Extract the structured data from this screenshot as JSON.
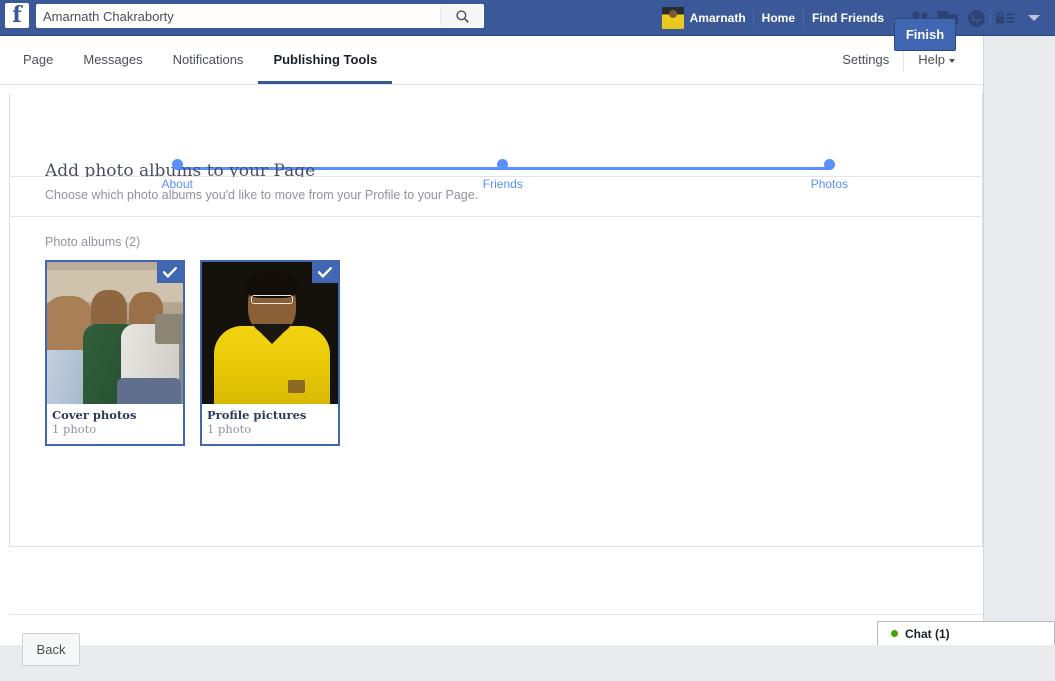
{
  "topbar": {
    "logo": "f",
    "search": {
      "value": "Amarnath Chakraborty",
      "placeholder": "Search",
      "icon": "search-icon"
    },
    "user_name": "Amarnath",
    "home_label": "Home",
    "find_friends_label": "Find Friends",
    "icons": [
      "friend-requests-icon",
      "messages-icon",
      "notifications-globe-icon",
      "privacy-lock-icon",
      "account-dropdown-icon"
    ],
    "background_color": "#3b5998"
  },
  "tabbar": {
    "tabs": [
      {
        "label": "Page",
        "active": false
      },
      {
        "label": "Messages",
        "active": false
      },
      {
        "label": "Notifications",
        "active": false
      },
      {
        "label": "Publishing Tools",
        "active": true
      }
    ],
    "settings_label": "Settings",
    "help_label": "Help",
    "active_color": "#365899"
  },
  "wizard": {
    "steps": [
      {
        "label": "About",
        "left_pct": 17.2
      },
      {
        "label": "Friends",
        "left_pct": 50.7
      },
      {
        "label": "Photos",
        "left_pct": 84.3
      }
    ],
    "step_color": "#5890ff",
    "heading": "Add photo albums to your Page",
    "subheading": "Choose which photo albums you'd like to move from your Profile to your Page.",
    "albums_title": "Photo albums (2)",
    "albums": [
      {
        "name": "Cover photos",
        "count": "1 photo",
        "selected": true,
        "check_icon": "checkmark-icon"
      },
      {
        "name": "Profile pictures",
        "count": "1 photo",
        "selected": true,
        "check_icon": "checkmark-icon"
      }
    ],
    "selected_border_color": "#4267b2"
  },
  "footer": {
    "back_label": "Back",
    "finish_label": "Finish"
  },
  "chat": {
    "label": "Chat (1)",
    "status_color": "#41a700"
  }
}
